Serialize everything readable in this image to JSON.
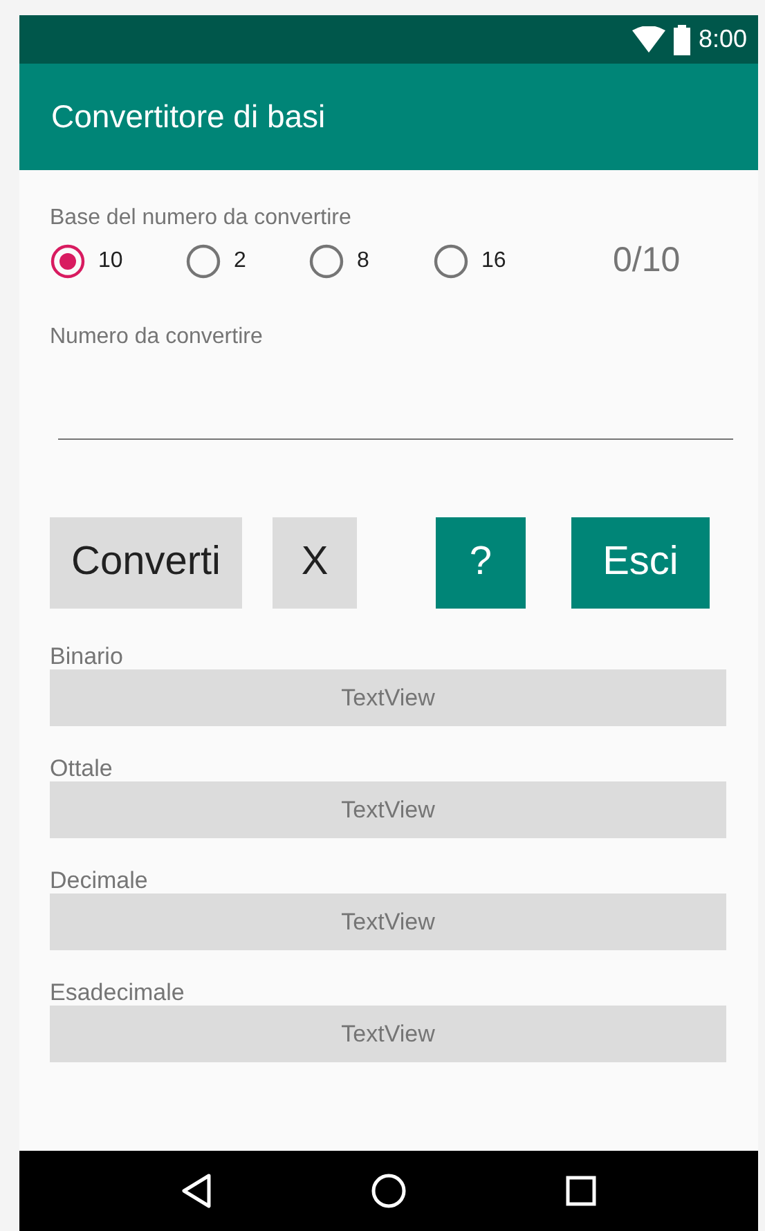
{
  "status_bar": {
    "time": "8:00"
  },
  "app_bar": {
    "title": "Convertitore di basi"
  },
  "base_group": {
    "label": "Base del numero da convertire",
    "counter": "0/10",
    "options": [
      {
        "label": "10",
        "selected": true
      },
      {
        "label": "2",
        "selected": false
      },
      {
        "label": "8",
        "selected": false
      },
      {
        "label": "16",
        "selected": false
      }
    ]
  },
  "number_field": {
    "label": "Numero da convertire"
  },
  "buttons": [
    {
      "label": "Converti",
      "kind": "secondary"
    },
    {
      "label": "X",
      "kind": "secondary"
    },
    {
      "label": "?",
      "kind": "primary"
    },
    {
      "label": "Esci",
      "kind": "primary"
    }
  ],
  "results": [
    {
      "label": "Binario",
      "value": "TextView"
    },
    {
      "label": "Ottale",
      "value": "TextView"
    },
    {
      "label": "Decimale",
      "value": "TextView"
    },
    {
      "label": "Esadecimale",
      "value": "TextView"
    }
  ]
}
